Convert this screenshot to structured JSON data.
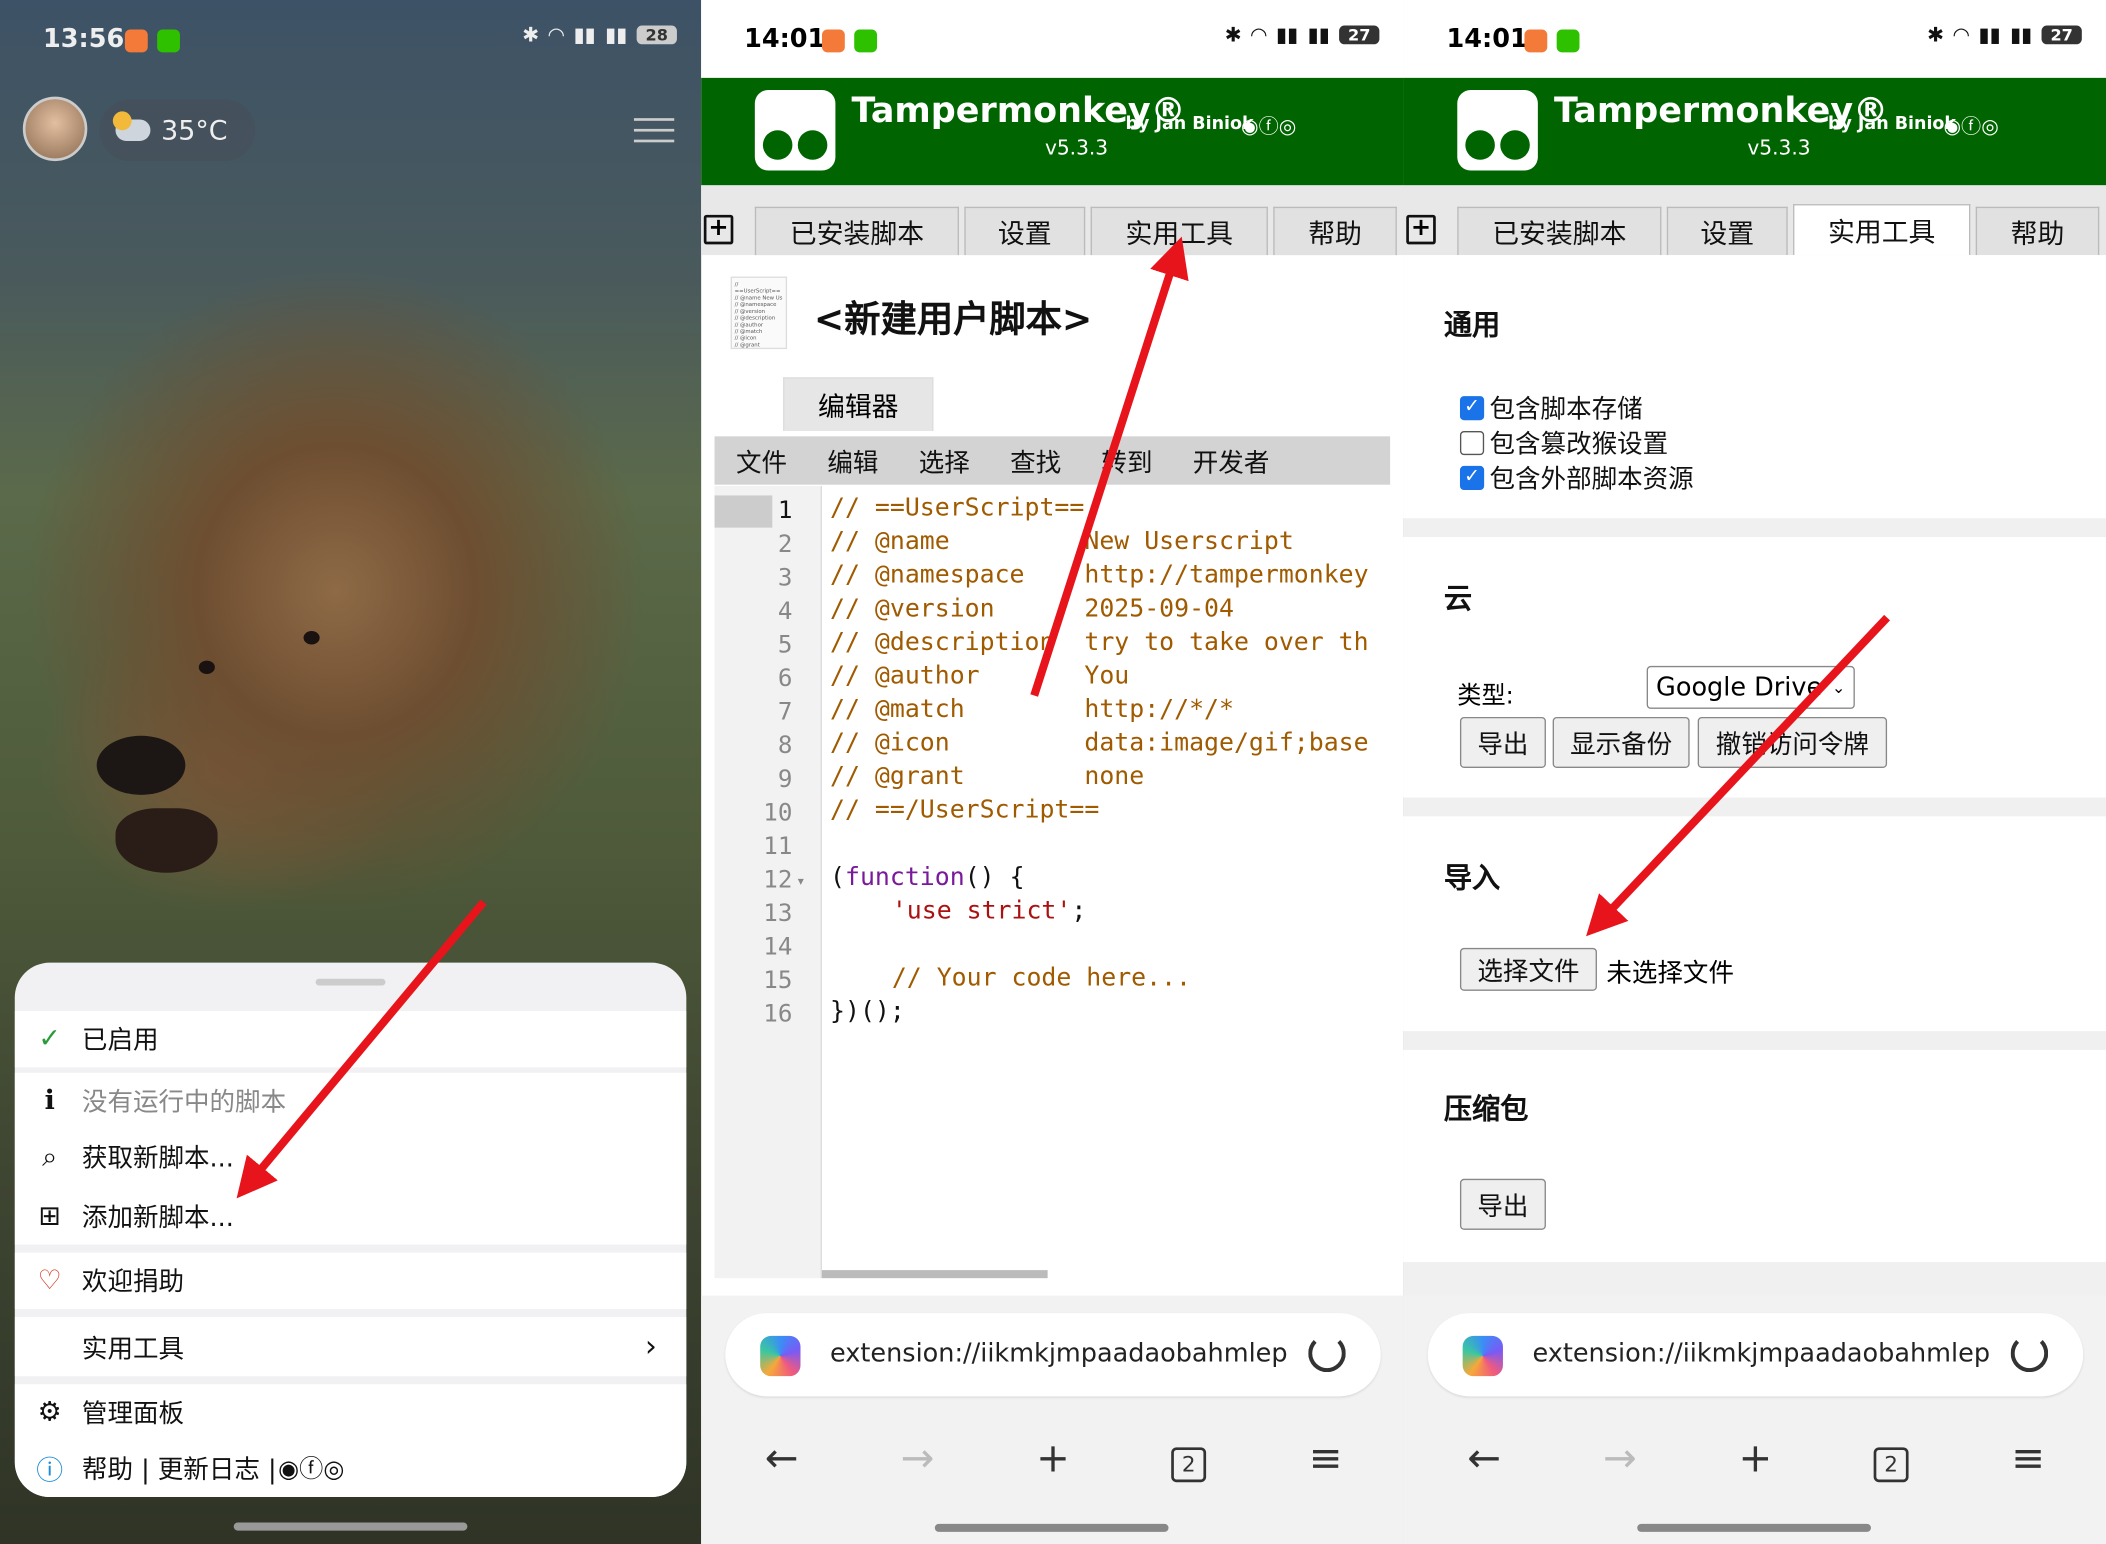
{
  "panel1": {
    "status": {
      "time": "13:56",
      "battery": "28"
    },
    "weather": {
      "temp": "35°C"
    },
    "menu": {
      "enabled": "已启用",
      "no_running": "没有运行中的脚本",
      "get_new": "获取新脚本...",
      "add_new": "添加新脚本...",
      "donate": "欢迎捐助",
      "utilities": "实用工具",
      "dashboard": "管理面板",
      "help": "帮助 | 更新日志 |"
    }
  },
  "tampermonkey": {
    "title": "Tampermonkey®",
    "version": "v5.3.3",
    "by": "by Jan Biniok"
  },
  "tabs": {
    "installed": "已安装脚本",
    "settings": "设置",
    "utilities": "实用工具",
    "help": "帮助"
  },
  "panel2": {
    "status": {
      "time": "14:01",
      "battery": "27"
    },
    "editor_title": "<新建用户脚本>",
    "editor_tab": "编辑器",
    "menubar": [
      "文件",
      "编辑",
      "选择",
      "查找",
      "转到",
      "开发者"
    ],
    "line_numbers": [
      "1",
      "2",
      "3",
      "4",
      "5",
      "6",
      "7",
      "8",
      "9",
      "10",
      "11",
      "12",
      "13",
      "14",
      "15",
      "16"
    ],
    "code": {
      "l1": "// ==UserScript==",
      "l2": "// @name         New Userscript",
      "l3": "// @namespace    http://tampermonkey",
      "l4": "// @version      2025-09-04",
      "l5": "// @description  try to take over th",
      "l6": "// @author       You",
      "l7": "// @match        http://*/*",
      "l8": "// @icon         data:image/gif;base",
      "l9": "// @grant        none",
      "l10": "// ==/UserScript==",
      "l12a": "(",
      "l12b": "function",
      "l12c": "() {",
      "l13": "'use strict'",
      "l13b": ";",
      "l15": "// Your code here...",
      "l16": "})();"
    }
  },
  "panel3": {
    "status": {
      "time": "14:01",
      "battery": "27"
    },
    "general": {
      "title": "通用",
      "opt1": "包含脚本存储",
      "opt2": "包含篡改猴设置",
      "opt3": "包含外部脚本资源"
    },
    "cloud": {
      "title": "云",
      "type_label": "类型:",
      "type_value": "Google Drive",
      "export": "导出",
      "show_backup": "显示备份",
      "revoke": "撤销访问令牌"
    },
    "import": {
      "title": "导入",
      "choose": "选择文件",
      "no_file": "未选择文件"
    },
    "zip": {
      "title": "压缩包",
      "export": "导出"
    }
  },
  "urlbar": {
    "url": "extension://iikmkjmpaadaobahmlep",
    "tab_count": "2"
  },
  "colors": {
    "tm_green": "#006400",
    "arrow": "#e8141b",
    "checkbox": "#1a73e8"
  }
}
